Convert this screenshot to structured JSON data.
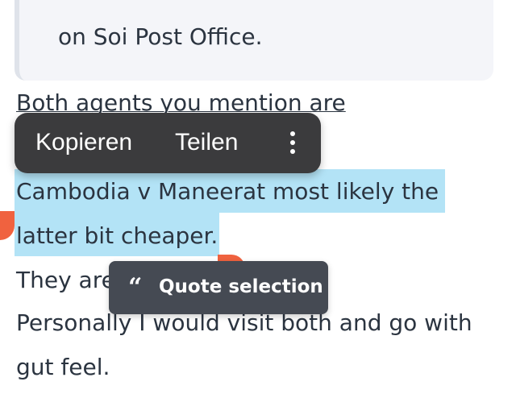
{
  "quote": {
    "text": "on Soi Post Office."
  },
  "post_lines": [
    "Both agents you mention are",
    "Cambodia v Maneerat most likely the",
    "latter bit cheaper.",
    "They are",
    "Personally I would visit both and go with",
    "gut feel."
  ],
  "context_menu": {
    "copy_label": "Kopieren",
    "share_label": "Teilen",
    "more_icon": "vertical-ellipsis-icon"
  },
  "quote_button": {
    "icon": "quote-marks-icon",
    "label": "Quote selection"
  },
  "colors": {
    "selection_highlight": "#b3e3f6",
    "handle": "#f0623f",
    "menu_bg": "#3b3b3d",
    "quote_button_bg": "#454a53",
    "text": "#2b3440"
  }
}
